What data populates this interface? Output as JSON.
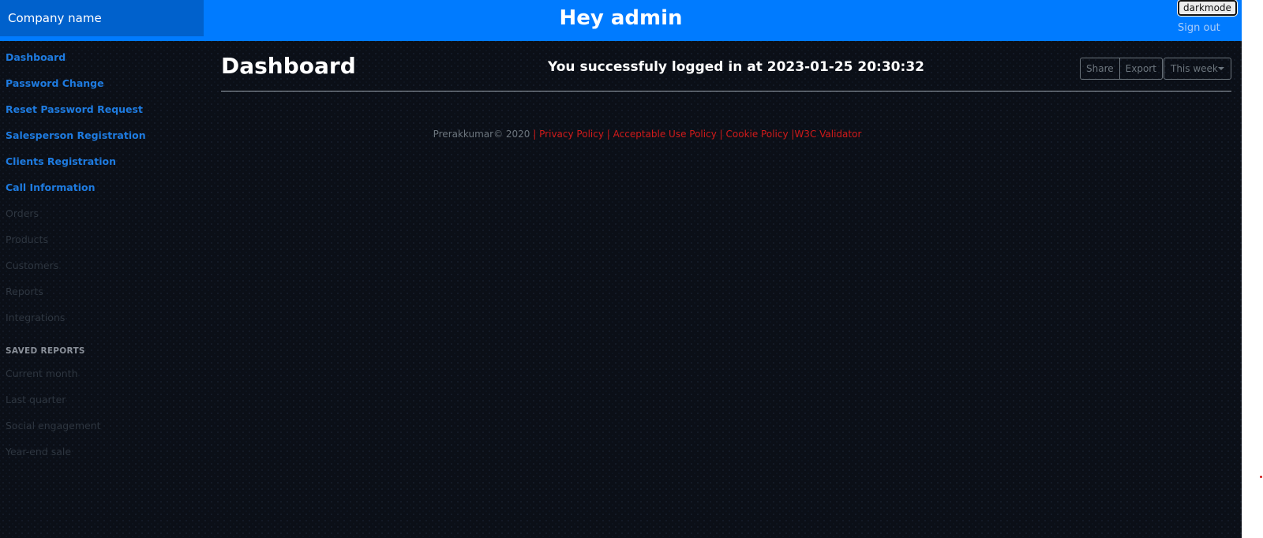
{
  "header": {
    "brand": "Company name",
    "greeting": "Hey admin",
    "darkmode_label": "darkmode",
    "signout_label": "Sign out",
    "colors": {
      "topbar": "#007bff",
      "brand_bg": "#0061cc"
    }
  },
  "sidebar": {
    "items": [
      {
        "label": "Dashboard",
        "active": true
      },
      {
        "label": "Password Change",
        "active": true
      },
      {
        "label": "Reset Password Request",
        "active": true
      },
      {
        "label": "Salesperson Registration",
        "active": true
      },
      {
        "label": "Clients Registration",
        "active": true
      },
      {
        "label": "Call Information",
        "active": true
      },
      {
        "label": "Orders",
        "active": false
      },
      {
        "label": "Products",
        "active": false
      },
      {
        "label": "Customers",
        "active": false
      },
      {
        "label": "Reports",
        "active": false
      },
      {
        "label": "Integrations",
        "active": false
      }
    ],
    "saved_reports_heading": "SAVED REPORTS",
    "saved_reports": [
      {
        "label": "Current month"
      },
      {
        "label": "Last quarter"
      },
      {
        "label": "Social engagement"
      },
      {
        "label": "Year-end sale"
      }
    ]
  },
  "main": {
    "title": "Dashboard",
    "login_message": "You successfuly logged in at 2023-01-25 20:30:32",
    "toolbar": {
      "share_label": "Share",
      "export_label": "Export",
      "range_label": "This week"
    }
  },
  "footer": {
    "copyright": "Prerakkumar© 2020",
    "sep1": "|",
    "privacy": "Privacy Policy",
    "sep2": "|",
    "acceptable_use": "Acceptable Use Policy",
    "sep3": "|",
    "cookie": "Cookie Policy",
    "sep4": "|",
    "w3c": "W3C Validator"
  }
}
